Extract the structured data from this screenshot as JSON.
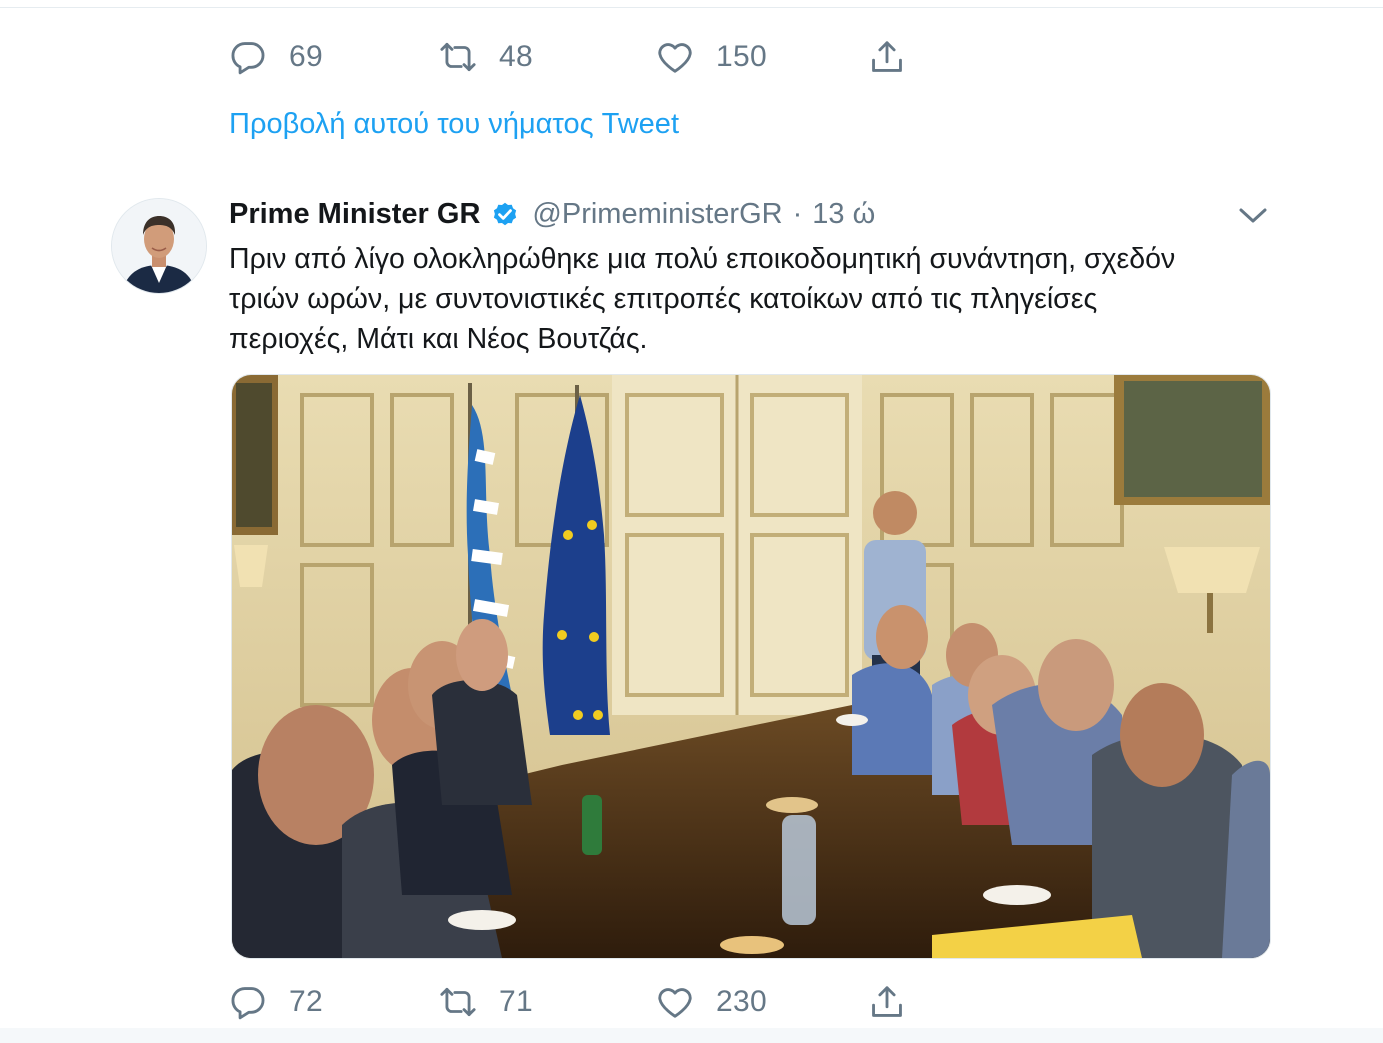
{
  "previous_tweet": {
    "actions": {
      "reply_count": "69",
      "retweet_count": "48",
      "like_count": "150"
    },
    "thread_link": "Προβολή αυτού του νήματος Tweet"
  },
  "tweet": {
    "author": {
      "display_name": "Prime Minister GR",
      "handle": "@PrimeministerGR",
      "verified": true
    },
    "separator": "·",
    "time": "13 ώ",
    "text_lines": [
      "Πριν από λίγο ολοκληρώθηκε μια πολύ εποικοδομητική συνάντηση, σχεδόν",
      "τριών ωρών, με συντονιστικές επιτροπές κατοίκων από τις πληγείσες",
      "περιοχές, Μάτι και Νέος Βουτζάς."
    ],
    "media": {
      "icon": "photo-meeting-room"
    },
    "actions": {
      "reply_count": "72",
      "retweet_count": "71",
      "like_count": "230"
    }
  },
  "colors": {
    "accent": "#1da1f2",
    "secondary_text": "#657786",
    "primary_text": "#14171a"
  },
  "icons": {
    "reply": "reply-icon",
    "retweet": "retweet-icon",
    "like": "heart-icon",
    "share": "share-icon",
    "verified": "verified-badge-icon",
    "menu": "chevron-down-icon"
  }
}
